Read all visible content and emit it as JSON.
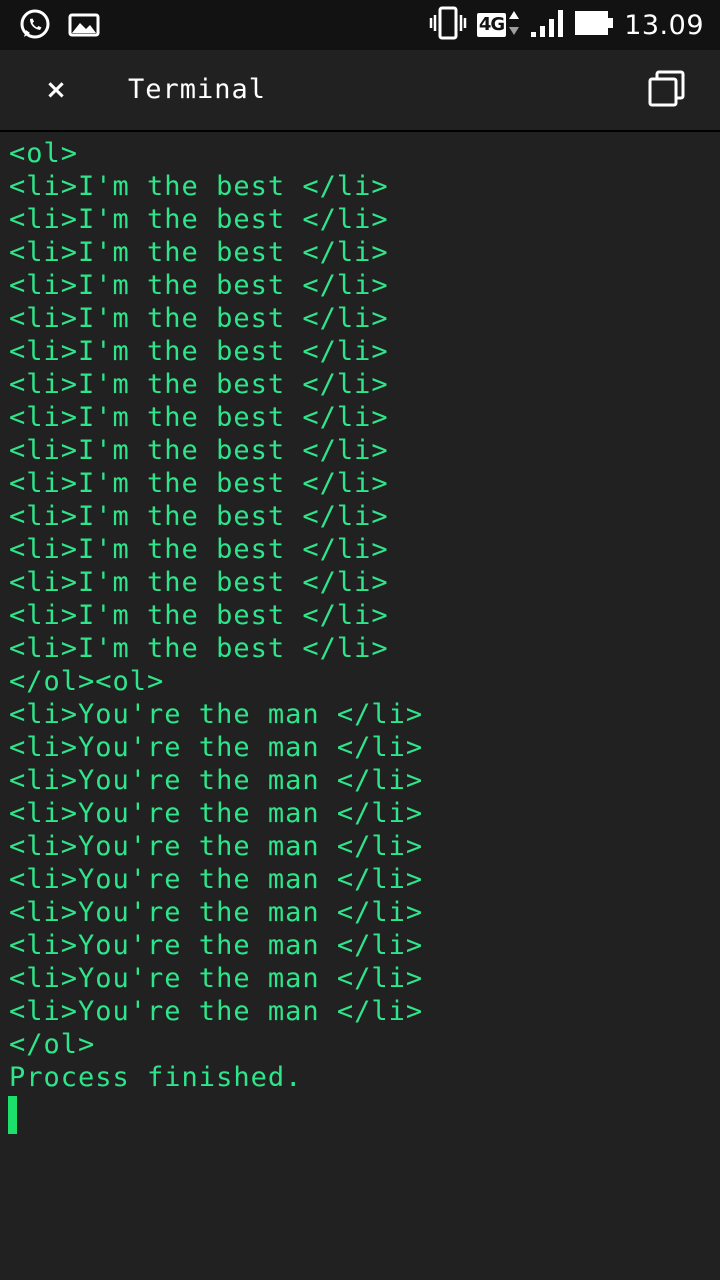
{
  "status_bar": {
    "left_icons": [
      "whatsapp-icon",
      "gallery-icon"
    ],
    "right_icons": [
      "vibrate-icon",
      "network-arrows-icon",
      "signal-icon",
      "battery-icon"
    ],
    "network_type": "4G",
    "time": "13.09"
  },
  "app_bar": {
    "close_label": "×",
    "title": "Terminal",
    "windows_icon": "windows-icon"
  },
  "terminal": {
    "text_color": "#2fe58a",
    "lines": [
      "<ol>",
      "<li>I'm the best </li>",
      "<li>I'm the best </li>",
      "<li>I'm the best </li>",
      "<li>I'm the best </li>",
      "<li>I'm the best </li>",
      "<li>I'm the best </li>",
      "<li>I'm the best </li>",
      "<li>I'm the best </li>",
      "<li>I'm the best </li>",
      "<li>I'm the best </li>",
      "<li>I'm the best </li>",
      "<li>I'm the best </li>",
      "<li>I'm the best </li>",
      "<li>I'm the best </li>",
      "<li>I'm the best </li>",
      "</ol><ol>",
      "<li>You're the man </li>",
      "<li>You're the man </li>",
      "<li>You're the man </li>",
      "<li>You're the man </li>",
      "<li>You're the man </li>",
      "<li>You're the man </li>",
      "<li>You're the man </li>",
      "<li>You're the man </li>",
      "<li>You're the man </li>",
      "<li>You're the man </li>",
      "</ol>",
      "Process finished."
    ]
  }
}
